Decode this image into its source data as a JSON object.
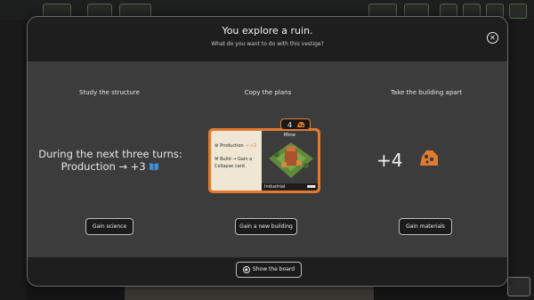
{
  "dialog": {
    "title": "You explore a ruin.",
    "subtitle": "What do you want to do with this vestige?",
    "close_icon": "close-icon",
    "show_board_label": "Show the board"
  },
  "options": {
    "study": {
      "heading": "Study the structure",
      "effect_line1": "During the next three turns:",
      "effect_line2": "Production → +3",
      "button": "Gain science"
    },
    "copy": {
      "heading": "Copy the plans",
      "button": "Gain a new building",
      "card": {
        "cost": "4",
        "name": "Mine",
        "type": "Industrial",
        "production_label": "Production",
        "production_value": "→ +2",
        "build_line1": "Build → Gain a",
        "build_line2": "Collapse card."
      }
    },
    "dismantle": {
      "heading": "Take the building apart",
      "materials_value": "+4",
      "button": "Gain materials"
    }
  },
  "colors": {
    "accent_orange": "#e37a2e",
    "science_blue": "#3f8fd8",
    "panel_dark": "#1e1e1e",
    "panel_mid": "#3c3c3c"
  }
}
